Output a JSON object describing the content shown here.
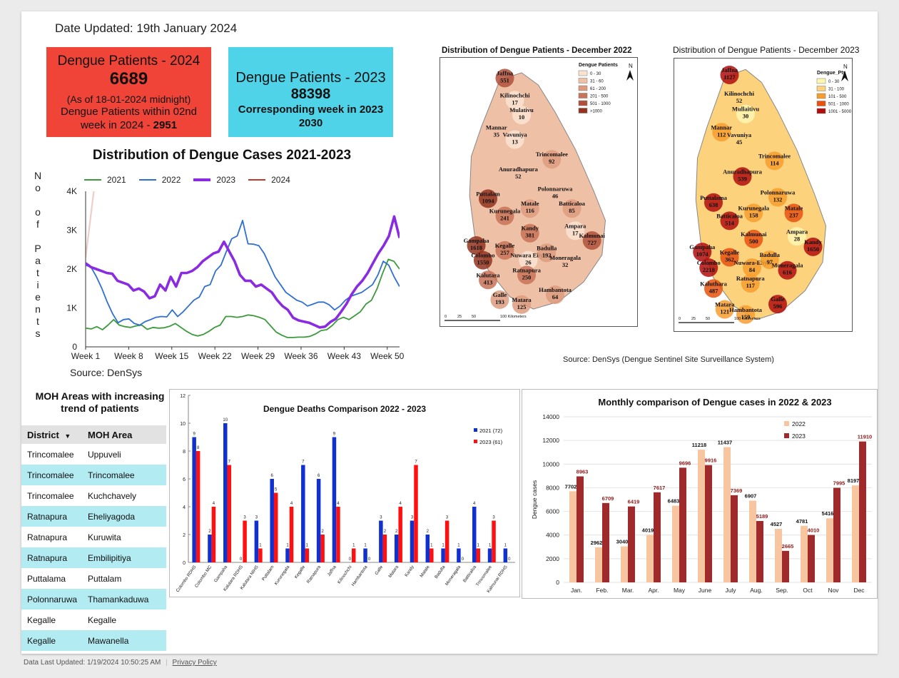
{
  "header": {
    "date_updated": "Date Updated:  19th January 2024"
  },
  "card_2024": {
    "title": "Dengue Patients - 2024",
    "value": "6689",
    "note": "(As of 18-01-2024 midnight)",
    "week_text": "Dengue Patients within 02nd week in 2024 - ",
    "week_value": "2951",
    "color": "#f04438"
  },
  "card_2023": {
    "title": "Dengue Patients - 2023",
    "value": "88398",
    "week_text": "Corresponding week in 2023",
    "week_value": "2030",
    "color": "#4fd3e8"
  },
  "line_chart_source": "Source: DenSys",
  "maps": {
    "map_2022_title": "Distribution of Dengue Patients - December 2022",
    "map_2022_legend_title": "Dengue Patients",
    "map_2022_legend": [
      "0 - 30",
      "31 - 60",
      "61 - 200",
      "201 - 500",
      "501 - 1000",
      ">1000"
    ],
    "map_2023_title": "Distribution of Dengue Patients - December 2023",
    "map_2023_legend_title": "Dengue_Pts",
    "map_2023_legend": [
      "0 - 30",
      "31 - 100",
      "101 - 500",
      "501 - 1000",
      "1001 - 5000"
    ],
    "scale_2022": [
      "0",
      "25",
      "50",
      "100 Kilometers"
    ],
    "scale_2023": [
      "0",
      "25",
      "50",
      "100 Kilometers"
    ],
    "north": "N",
    "source": "Source: DenSys (Dengue Sentinel Site Surveillance System)",
    "districts_2022": [
      [
        "Jaffna",
        "551"
      ],
      [
        "Kilinochchi",
        "17"
      ],
      [
        "Mulativu",
        "10"
      ],
      [
        "Mannar",
        "35"
      ],
      [
        "Vavuniya",
        "13"
      ],
      [
        "Trincomalee",
        "92"
      ],
      [
        "Anuradhapura",
        "52"
      ],
      [
        "Puttalam",
        "1094"
      ],
      [
        "Polonnaruwa",
        "46"
      ],
      [
        "Batticaloa",
        "85"
      ],
      [
        "Kurunegala",
        "241"
      ],
      [
        "Matale",
        "116"
      ],
      [
        "Ampara",
        "17"
      ],
      [
        "Kalmunai",
        "727"
      ],
      [
        "Kandy",
        "381"
      ],
      [
        "Gampaha",
        "1618"
      ],
      [
        "Kegalle",
        "257"
      ],
      [
        "Colombo",
        "1550"
      ],
      [
        "Nuwara Eliya",
        "26"
      ],
      [
        "Badulla",
        "192"
      ],
      [
        "Moneragala",
        "32"
      ],
      [
        "Kalutara",
        "413"
      ],
      [
        "Ratnapura",
        "250"
      ],
      [
        "Hambantota",
        "64"
      ],
      [
        "Galle",
        "193"
      ],
      [
        "Matara",
        "125"
      ]
    ],
    "districts_2023": [
      [
        "Jaffna",
        "1127"
      ],
      [
        "Kilinochchi",
        "52"
      ],
      [
        "Mullaitivu",
        "30"
      ],
      [
        "Mannar",
        "112"
      ],
      [
        "Vavuniya",
        "45"
      ],
      [
        "Trincomalee",
        "114"
      ],
      [
        "Anuradhapura",
        "539"
      ],
      [
        "Puttalama",
        "638"
      ],
      [
        "Polonnaruwa",
        "132"
      ],
      [
        "Matale",
        "237"
      ],
      [
        "Batticaloa",
        "514"
      ],
      [
        "Kurunegala",
        "158"
      ],
      [
        "Ampara",
        "28"
      ],
      [
        "Kandy",
        "1650"
      ],
      [
        "Kalmunai",
        "500"
      ],
      [
        "Gampaha",
        "1074"
      ],
      [
        "Kegalle",
        "362"
      ],
      [
        "Colombo",
        "2218"
      ],
      [
        "Nuwara-Eliya",
        "84"
      ],
      [
        "Badulla",
        "97"
      ],
      [
        "Moneragala",
        "616"
      ],
      [
        "Kalutharа",
        "487"
      ],
      [
        "Ratnapura",
        "117"
      ],
      [
        "Galle",
        "596"
      ],
      [
        "Matara",
        "121"
      ],
      [
        "Hambantota",
        "159"
      ]
    ]
  },
  "moh": {
    "title": "MOH Areas with increasing trend of patients",
    "col_district": "District",
    "col_area": "MOH Area",
    "rows": [
      [
        "Trincomalee",
        "Uppuveli"
      ],
      [
        "Trincomalee",
        "Trincomalee"
      ],
      [
        "Trincomalee",
        "Kuchchavely"
      ],
      [
        "Ratnapura",
        "Eheliyagoda"
      ],
      [
        "Ratnapura",
        "Kuruwita"
      ],
      [
        "Ratnapura",
        "Embilipitiya"
      ],
      [
        "Puttalama",
        "Puttalam"
      ],
      [
        "Polonnaruwa",
        "Thamankaduwa"
      ],
      [
        "Kegalle",
        "Kegalle"
      ],
      [
        "Kegalle",
        "Mawanella"
      ]
    ]
  },
  "footer": {
    "updated": "Data Last Updated: 1/19/2024 10:50:25 AM",
    "privacy": "Privacy Policy"
  },
  "chart_data": [
    {
      "type": "line",
      "title": "Distribution of Dengue Cases 2021-2023",
      "ylabel": "No of Patients",
      "xlabel": "",
      "x_ticks": [
        "Week 1",
        "Week 8",
        "Week 15",
        "Week 22",
        "Week 29",
        "Week 36",
        "Week 43",
        "Week 50"
      ],
      "y_ticks": [
        "0",
        "1K",
        "2K",
        "3K",
        "4K"
      ],
      "ylim": [
        0,
        4000
      ],
      "xlim": [
        1,
        52
      ],
      "grid": false,
      "legend_position": "top",
      "series": [
        {
          "name": "2021",
          "color": "#3c9a3c",
          "width": 1.8,
          "values": [
            480,
            460,
            520,
            440,
            560,
            700,
            560,
            520,
            500,
            540,
            560,
            450,
            500,
            480,
            490,
            530,
            600,
            500,
            400,
            320,
            280,
            320,
            400,
            500,
            560,
            780,
            780,
            760,
            780,
            820,
            800,
            760,
            700,
            540,
            380,
            300,
            240,
            240,
            250,
            250,
            270,
            330,
            420,
            440,
            550,
            700,
            760,
            700,
            800,
            900,
            1100,
            1200,
            1500,
            1900,
            2250,
            2200,
            2000
          ]
        },
        {
          "name": "2022",
          "color": "#2f6fd0",
          "width": 1.8,
          "values": [
            2100,
            2050,
            1800,
            1500,
            1150,
            850,
            620,
            700,
            720,
            600,
            560,
            650,
            700,
            760,
            780,
            770,
            950,
            780,
            900,
            1050,
            1200,
            1280,
            1550,
            1600,
            1950,
            2100,
            2450,
            2780,
            2850,
            3250,
            2650,
            2640,
            2600,
            2400,
            2100,
            1800,
            1600,
            1400,
            1300,
            1200,
            1150,
            1050,
            1100,
            1150,
            1150,
            1080,
            950,
            1050,
            1200,
            1300,
            1350,
            1400,
            1500,
            1600,
            1850,
            2200,
            2100,
            1800,
            1550
          ]
        },
        {
          "name": "2023",
          "color": "#8a2be2",
          "width": 3.6,
          "values": [
            2150,
            2050,
            2000,
            1950,
            1900,
            1880,
            1700,
            1650,
            1600,
            1450,
            1500,
            1420,
            1250,
            1300,
            1600,
            1450,
            1800,
            1550,
            1900,
            1900,
            1950,
            2050,
            2200,
            2300,
            2400,
            2450,
            2700,
            2450,
            2200,
            1850,
            1700,
            1700,
            1550,
            1600,
            1500,
            1400,
            1200,
            1050,
            950,
            750,
            680,
            650,
            620,
            560,
            500,
            520,
            640,
            720,
            900,
            1100,
            1350,
            1550,
            1700,
            1900,
            2150,
            2400,
            2600,
            2850,
            3350,
            2800
          ]
        },
        {
          "name": "2024",
          "color": "#c0392b",
          "width": 2.2,
          "values": [
            2300,
            5500
          ]
        }
      ]
    },
    {
      "type": "bar",
      "title": "Dengue Deaths Comparison 2022 - 2023",
      "ylim": [
        0,
        12
      ],
      "y_ticks": [
        0,
        2,
        4,
        6,
        8,
        10,
        12
      ],
      "legend_position": "top-right",
      "categories": [
        "Colombo RDHS",
        "Colombo MC",
        "Gampaha",
        "Kalutara RDHS",
        "Kalutara NIHS",
        "Puttalam",
        "Kurunegala",
        "Kegalle",
        "Ratnapura",
        "Jaffna",
        "Kilinochchi",
        "Hambantota",
        "Galle",
        "Matara",
        "Kandy",
        "Matale",
        "Badulla",
        "Moneragala",
        "Batticaloa",
        "Trincomalee",
        "Kalmunai RDHS"
      ],
      "series": [
        {
          "name": "2021  (72)",
          "color": "#1030d0",
          "values": [
            9,
            2,
            10,
            0,
            3,
            6,
            1,
            7,
            6,
            9,
            0,
            1,
            3,
            2,
            3,
            2,
            1,
            1,
            4,
            1,
            1
          ]
        },
        {
          "name": "2023  (61)",
          "color": "#ff1010",
          "values": [
            8,
            4,
            7,
            3,
            1,
            5,
            4,
            1,
            2,
            4,
            1,
            0,
            2,
            4,
            7,
            1,
            3,
            0,
            1,
            3,
            0
          ]
        }
      ]
    },
    {
      "type": "bar",
      "title": "Monthly comparison of Dengue cases in 2022 & 2023",
      "ylabel": "Dengue cases",
      "ylim": [
        0,
        14000
      ],
      "y_ticks": [
        0,
        2000,
        4000,
        6000,
        8000,
        10000,
        12000,
        14000
      ],
      "legend_position": "top-right",
      "categories": [
        "Jan.",
        "Feb.",
        "Mar.",
        "Apr.",
        "May",
        "June",
        "July",
        "Aug.",
        "Sep.",
        "Oct",
        "Nov",
        "Dec"
      ],
      "series": [
        {
          "name": "2022",
          "color": "#f7c59f",
          "values": [
            7702,
            2962,
            3040,
            4019,
            6483,
            11218,
            11437,
            6907,
            4527,
            4781,
            5416,
            8197
          ]
        },
        {
          "name": "2023",
          "color": "#9e2a2b",
          "values": [
            8963,
            6709,
            6419,
            7617,
            9696,
            9916,
            7369,
            5189,
            2665,
            4010,
            7995,
            11910
          ]
        }
      ]
    }
  ]
}
